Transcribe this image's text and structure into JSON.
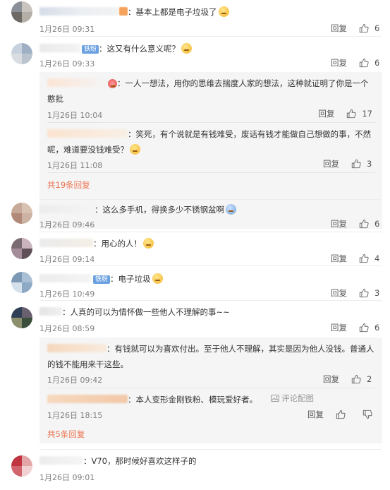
{
  "ui": {
    "reply_label": "回复",
    "accent": "#eb7350",
    "fan_badge": "铁粉",
    "comment_sep": "：",
    "report_label": "评论配图"
  },
  "comments": [
    {
      "id": "c1",
      "text": "基本上都是电子垃圾了",
      "emoji": "laughing-tears-emoji",
      "time": "1月26日 09:31",
      "likes": "6"
    },
    {
      "id": "c2",
      "text": "这又有什么意义呢？",
      "emoji": "thinking-emoji",
      "fan": true,
      "time": "1月26日 09:33",
      "likes": "6",
      "replies": [
        {
          "text": "一人一想法，用你的思维去揣度人家的想法，这种就证明了你是一个憨批",
          "time": "1月26日 10:04",
          "likes": "17"
        },
        {
          "text": "笑死，有个说就是有钱难受，废话有钱才能做自己想做的事，不然呢，难道要没钱难受？",
          "time": "1月26日 11:08",
          "likes": "3"
        }
      ],
      "more": "共19条回复"
    },
    {
      "id": "c3",
      "text": "这么多手机，得换多少不锈钢盆啊",
      "emoji": "blue-face-emoji",
      "time": "1月26日 09:46",
      "likes": "6"
    },
    {
      "id": "c4",
      "text": "用心的人！",
      "emoji": "thumbs-up-emoji",
      "time": "1月26日 09:14",
      "likes": "4"
    },
    {
      "id": "c5",
      "text": "电子垃圾",
      "emoji": "laughing-tears-emoji",
      "fan": true,
      "time": "1月26日 10:49",
      "likes": "3"
    },
    {
      "id": "c6",
      "text": "人真的可以为情怀做一些他人不理解的事~~",
      "time": "1月26日 08:59",
      "likes": "6",
      "replies": [
        {
          "text": "有钱就可以为喜欢付出。至于他人不理解，其实是因为他人没钱。普通人的钱不能用来干这些。",
          "time": "1月26日 09:42",
          "likes": "2"
        },
        {
          "text": "本人变形金刚铁粉、模玩爱好者。",
          "time": "1月26日 18:15",
          "likes": "",
          "report": true
        }
      ],
      "more": "共5条回复"
    },
    {
      "id": "c7",
      "text": "V70，那时候好喜欢这样子的",
      "time": "1月26日 09:01",
      "likes": ""
    }
  ]
}
